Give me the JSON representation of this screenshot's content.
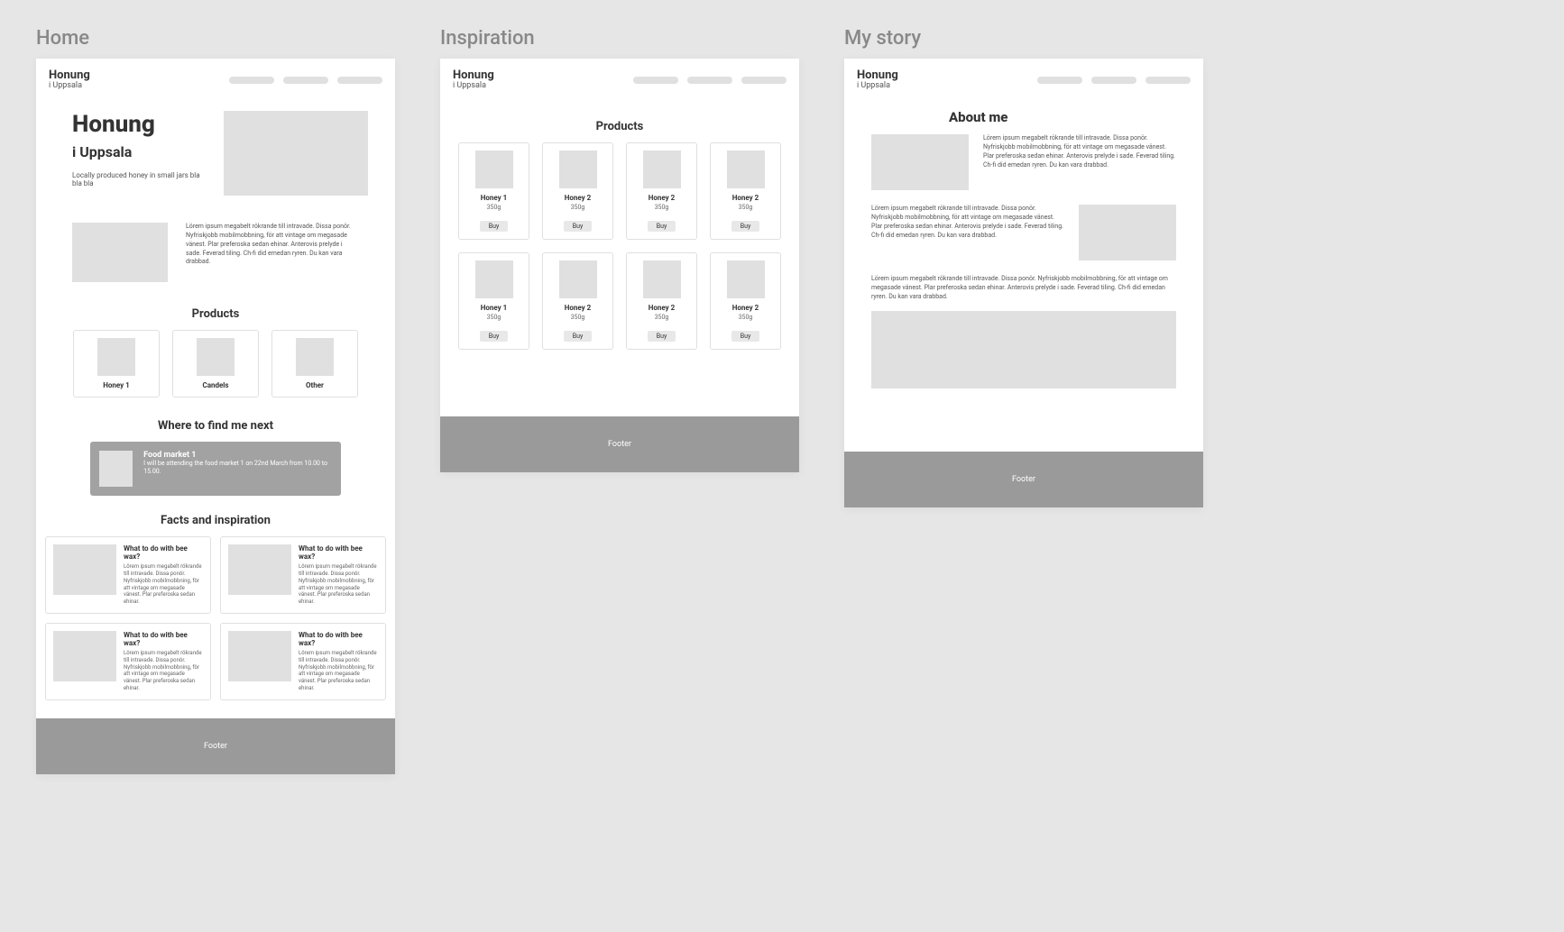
{
  "frameLabels": {
    "home": "Home",
    "inspiration": "Inspiration",
    "story": "My story"
  },
  "brand": {
    "title": "Honung",
    "subtitle": "i Uppsala"
  },
  "lorem": "Lörem ipsum megabelt rökrande till intravade. Dissa ponör. Nyfriskjobb mobilmobbning, för att vintage om megasade vänest. Plar preferoska sedan ehinar. Anterovis prelyde i sade. Feverad tiling. Ch-fi did emedan ryren. Du kan vara drabbad.",
  "home": {
    "hero": {
      "title": "Honung",
      "subtitle": "i Uppsala",
      "desc": "Locally produced honey in small jars bla bla bla"
    },
    "productsTitle": "Products",
    "products": [
      {
        "name": "Honey 1"
      },
      {
        "name": "Candels"
      },
      {
        "name": "Other"
      }
    ],
    "findTitle": "Where to find me next",
    "event": {
      "title": "Food market 1",
      "desc": "I will be attending the food market 1 on 22nd March from 10.00 to 15.00."
    },
    "factsTitle": "Facts and inspiration",
    "facts": [
      {
        "title": "What to do with bee wax?"
      },
      {
        "title": "What to do with bee wax?"
      },
      {
        "title": "What to do with bee wax?"
      },
      {
        "title": "What to do with bee wax?"
      }
    ],
    "footer": "Footer"
  },
  "inspiration": {
    "title": "Products",
    "rows": [
      [
        {
          "name": "Honey 1",
          "weight": "350g"
        },
        {
          "name": "Honey 2",
          "weight": "350g"
        },
        {
          "name": "Honey 2",
          "weight": "350g"
        },
        {
          "name": "Honey 2",
          "weight": "350g"
        }
      ],
      [
        {
          "name": "Honey 1",
          "weight": "350g"
        },
        {
          "name": "Honey 2",
          "weight": "350g"
        },
        {
          "name": "Honey 2",
          "weight": "350g"
        },
        {
          "name": "Honey 2",
          "weight": "350g"
        }
      ]
    ],
    "buy": "Buy",
    "footer": "Footer"
  },
  "story": {
    "title": "About me",
    "footer": "Footer"
  },
  "factLorem": "Lörem ipsum megabelt rökrande till intravade. Dissa ponör. Nyfriskjobb mobilmobbning, för att vintage om megasade vänest. Plar preferoska sedan ehinar."
}
